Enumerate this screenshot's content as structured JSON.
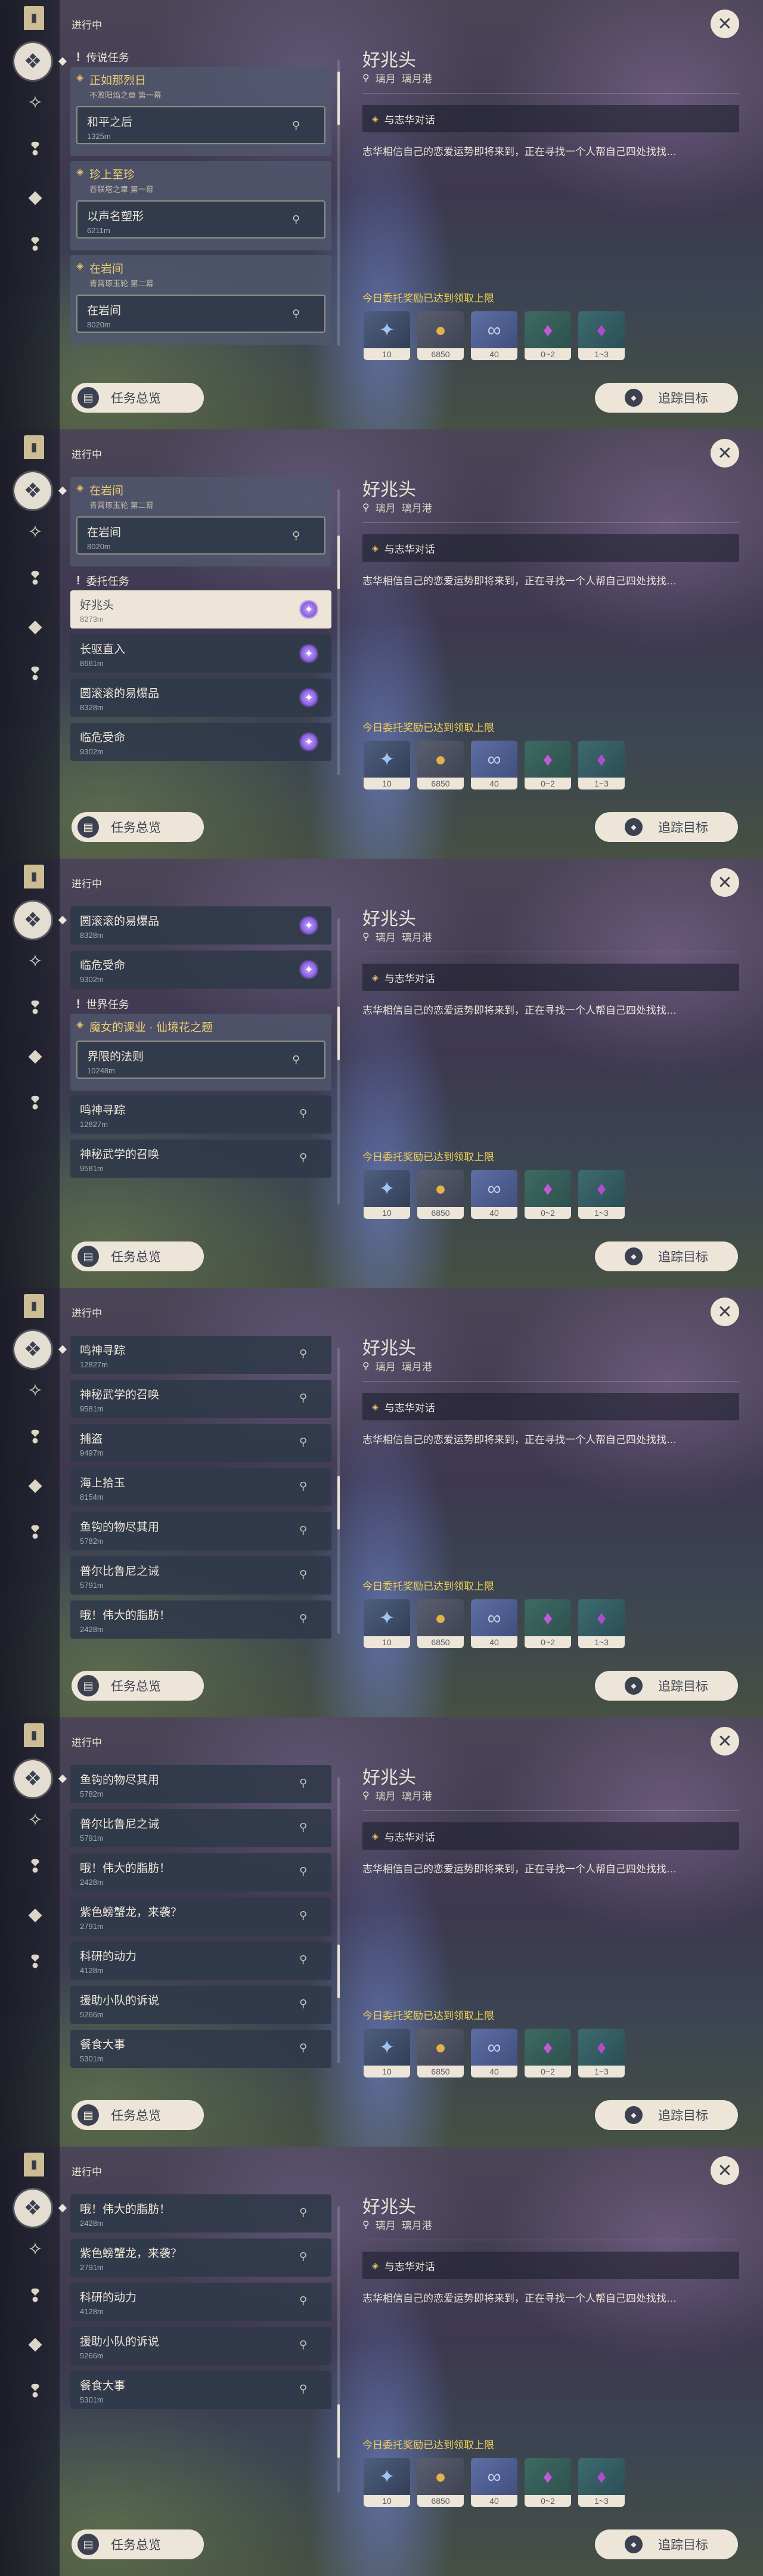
{
  "ui": {
    "status": "进行中",
    "overview": "任务总览",
    "track": "追踪目标",
    "close_glyph": "✕",
    "bookmark_glyph": "▮",
    "alert_glyph": "!"
  },
  "sections": {
    "legend": "传说任务",
    "commission": "委托任务",
    "world": "世界任务"
  },
  "sidebar_icons": [
    "bookmark-icon",
    "all-quests-icon",
    "archon-icon",
    "story-icon",
    "world-icon",
    "commission-icon"
  ],
  "detail": {
    "title": "好兆头",
    "location_country": "璃月",
    "location_area": "璃月港",
    "objective": "与志华对话",
    "description": "志华相信自己的恋爱运势即将来到，正在寻找一个人帮自己四处找找…",
    "notice": "今日委托奖励已达到领取上限"
  },
  "rewards": [
    {
      "name": "adventure-exp-icon",
      "count": "10"
    },
    {
      "name": "mora-icon",
      "count": "6850"
    },
    {
      "name": "companionship-exp-icon",
      "count": "40"
    },
    {
      "name": "primogem-crystal-icon",
      "count": "0~2"
    },
    {
      "name": "crystal-chunk-icon",
      "count": "1~3"
    }
  ],
  "frames": [
    {
      "scroll_pos": 0.05,
      "items": [
        {
          "kind": "section",
          "label": "传说任务",
          "ref": "legend"
        },
        {
          "kind": "chain",
          "title": "正如那烈日",
          "subtitle": "不败阳焰之章 第一幕",
          "sub_title": "和平之后",
          "sub_dist": "1325m"
        },
        {
          "kind": "chain",
          "title": "珍上至珍",
          "subtitle": "吞联塔之章 第一幕",
          "sub_title": "以声名塑形",
          "sub_dist": "6211m"
        },
        {
          "kind": "chain",
          "title": "在岩间",
          "subtitle": "青霄琢玉轮 第二幕",
          "sub_title": "在岩间",
          "sub_dist": "8020m"
        }
      ]
    },
    {
      "scroll_pos": 0.2,
      "items": [
        {
          "kind": "chain",
          "title": "在岩间",
          "subtitle": "青霄琢玉轮 第二幕",
          "sub_title": "在岩间",
          "sub_dist": "8020m"
        },
        {
          "kind": "section",
          "label": "委托任务",
          "ref": "commission"
        },
        {
          "kind": "quest",
          "title": "好兆头",
          "dist": "8273m",
          "icon": "gem",
          "selected": true
        },
        {
          "kind": "quest",
          "title": "长驱直入",
          "dist": "8661m",
          "icon": "gem"
        },
        {
          "kind": "quest",
          "title": "圆滚滚的易爆品",
          "dist": "8328m",
          "icon": "gem"
        },
        {
          "kind": "quest",
          "title": "临危受命",
          "dist": "9302m",
          "icon": "gem"
        }
      ]
    },
    {
      "scroll_pos": 0.38,
      "items": [
        {
          "kind": "quest",
          "title": "圆滚滚的易爆品",
          "dist": "8328m",
          "icon": "gem"
        },
        {
          "kind": "quest",
          "title": "临危受命",
          "dist": "9302m",
          "icon": "gem"
        },
        {
          "kind": "section",
          "label": "世界任务",
          "ref": "world"
        },
        {
          "kind": "chain",
          "title": "魔女的课业 · 仙境花之题",
          "subtitle": "",
          "sub_title": "界限的法则",
          "sub_dist": "10248m"
        },
        {
          "kind": "quest",
          "title": "鸣神寻踪",
          "dist": "12827m",
          "icon": "pin"
        },
        {
          "kind": "quest",
          "title": "神秘武学的召唤",
          "dist": "9581m",
          "icon": "pin"
        }
      ]
    },
    {
      "scroll_pos": 0.55,
      "items": [
        {
          "kind": "quest",
          "title": "鸣神寻踪",
          "dist": "12827m",
          "icon": "pin"
        },
        {
          "kind": "quest",
          "title": "神秘武学的召唤",
          "dist": "9581m",
          "icon": "pin"
        },
        {
          "kind": "quest",
          "title": "捕盗",
          "dist": "9497m",
          "icon": "pin"
        },
        {
          "kind": "quest",
          "title": "海上拾玉",
          "dist": "8154m",
          "icon": "pin"
        },
        {
          "kind": "quest",
          "title": "鱼钩的物尽其用",
          "dist": "5782m",
          "icon": "pin"
        },
        {
          "kind": "quest",
          "title": "普尔比鲁尼之诫",
          "dist": "5791m",
          "icon": "pin"
        },
        {
          "kind": "quest",
          "title": "哦！伟大的脂肪！",
          "dist": "2428m",
          "icon": "pin"
        }
      ]
    },
    {
      "scroll_pos": 0.72,
      "items": [
        {
          "kind": "quest",
          "title": "鱼钩的物尽其用",
          "dist": "5782m",
          "icon": "pin"
        },
        {
          "kind": "quest",
          "title": "普尔比鲁尼之诫",
          "dist": "5791m",
          "icon": "pin"
        },
        {
          "kind": "quest",
          "title": "哦！伟大的脂肪！",
          "dist": "2428m",
          "icon": "pin"
        },
        {
          "kind": "quest",
          "title": "紫色螃蟹龙，来袭？",
          "dist": "2791m",
          "icon": "pin"
        },
        {
          "kind": "quest",
          "title": "科研的动力",
          "dist": "4128m",
          "icon": "pin"
        },
        {
          "kind": "quest",
          "title": "援助小队的诉说",
          "dist": "5266m",
          "icon": "pin"
        },
        {
          "kind": "quest",
          "title": "餐食大事",
          "dist": "5301m",
          "icon": "pin"
        }
      ]
    },
    {
      "scroll_pos": 0.85,
      "items": [
        {
          "kind": "quest",
          "title": "哦！伟大的脂肪！",
          "dist": "2428m",
          "icon": "pin"
        },
        {
          "kind": "quest",
          "title": "紫色螃蟹龙，来袭？",
          "dist": "2791m",
          "icon": "pin"
        },
        {
          "kind": "quest",
          "title": "科研的动力",
          "dist": "4128m",
          "icon": "pin"
        },
        {
          "kind": "quest",
          "title": "援助小队的诉说",
          "dist": "5266m",
          "icon": "pin"
        },
        {
          "kind": "quest",
          "title": "餐食大事",
          "dist": "5301m",
          "icon": "pin"
        }
      ]
    }
  ]
}
